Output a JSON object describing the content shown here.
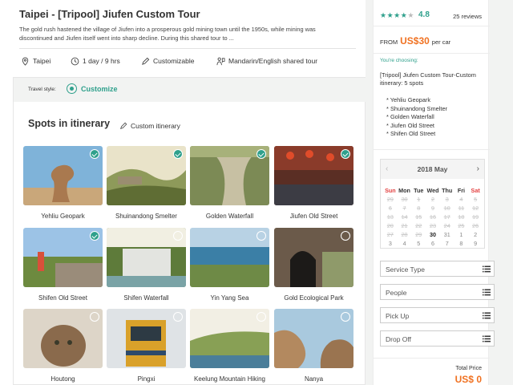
{
  "tour": {
    "title": "Taipei - [Tripool] Jiufen Custom Tour",
    "description": "The gold rush hastened the village of Jiufen into a prosperous gold mining town until the 1950s, while mining was discontinued and Jiufen itself went into sharp decline. During this shared tour to ...",
    "features": [
      {
        "icon": "location-pin-icon",
        "label": "Taipei"
      },
      {
        "icon": "clock-icon",
        "label": "1 day / 9 hrs"
      },
      {
        "icon": "pencil-icon",
        "label": "Customizable"
      },
      {
        "icon": "language-icon",
        "label": "Mandarin/English shared tour"
      }
    ]
  },
  "travel_style": {
    "label": "Travel style:",
    "selected": "Customize"
  },
  "spots_section": {
    "title": "Spots in itinerary",
    "custom_link": "Custom itinerary"
  },
  "spots": [
    {
      "name": "Yehliu Geopark",
      "selected": true,
      "scene": "rock-sky"
    },
    {
      "name": "Shuinandong Smelter",
      "selected": true,
      "scene": "hills"
    },
    {
      "name": "Golden Waterfall",
      "selected": true,
      "scene": "falls"
    },
    {
      "name": "Jiufen Old Street",
      "selected": true,
      "scene": "street"
    },
    {
      "name": "Shifen Old Street",
      "selected": true,
      "scene": "rail"
    },
    {
      "name": "Shifen Waterfall",
      "selected": false,
      "scene": "falls2"
    },
    {
      "name": "Yin Yang Sea",
      "selected": false,
      "scene": "sea"
    },
    {
      "name": "Gold Ecological Park",
      "selected": false,
      "scene": "tunnel"
    },
    {
      "name": "Houtong",
      "selected": false,
      "scene": "cat"
    },
    {
      "name": "Pingxi",
      "selected": false,
      "scene": "train"
    },
    {
      "name": "Keelung Mountain Hiking Trail",
      "selected": false,
      "scene": "coast"
    },
    {
      "name": "Nanya",
      "selected": false,
      "scene": "rocks"
    }
  ],
  "booking": {
    "rating": 4.8,
    "rating_text": "4.8",
    "reviews": "25 reviews",
    "from_label": "FROM",
    "price": "US$30",
    "price_unit": "per car",
    "choosing_label": "You're choosing:",
    "itinerary_title": "[Tripool] Jiufen Custom Tour-Custom itinerary: 5 spots",
    "itinerary_spots": [
      "Yehliu Geopark",
      "Shuinandong Smelter",
      "Golden Waterfall",
      "Jiufen Old Street",
      "Shifen Old Street"
    ],
    "calendar": {
      "title": "2018 May",
      "prev": "‹",
      "next": "›",
      "days_of_week": [
        "Sun",
        "Mon",
        "Tue",
        "Wed",
        "Thu",
        "Fri",
        "Sat"
      ],
      "weeks": [
        [
          "29",
          "30",
          "1",
          "2",
          "3",
          "4",
          "5"
        ],
        [
          "6",
          "7",
          "8",
          "9",
          "10",
          "11",
          "12"
        ],
        [
          "13",
          "14",
          "15",
          "16",
          "17",
          "18",
          "19"
        ],
        [
          "20",
          "21",
          "22",
          "23",
          "24",
          "25",
          "26"
        ],
        [
          "27",
          "28",
          "29",
          "30",
          "31",
          "1",
          "2"
        ],
        [
          "3",
          "4",
          "5",
          "6",
          "7",
          "8",
          "9"
        ]
      ],
      "today": "30"
    },
    "fields": [
      "Service Type",
      "People",
      "Pick Up",
      "Drop Off"
    ],
    "total_label": "Total Price",
    "total_price": "US$ 0"
  },
  "colors": {
    "accent": "#2fa08c",
    "price": "#f07222"
  }
}
